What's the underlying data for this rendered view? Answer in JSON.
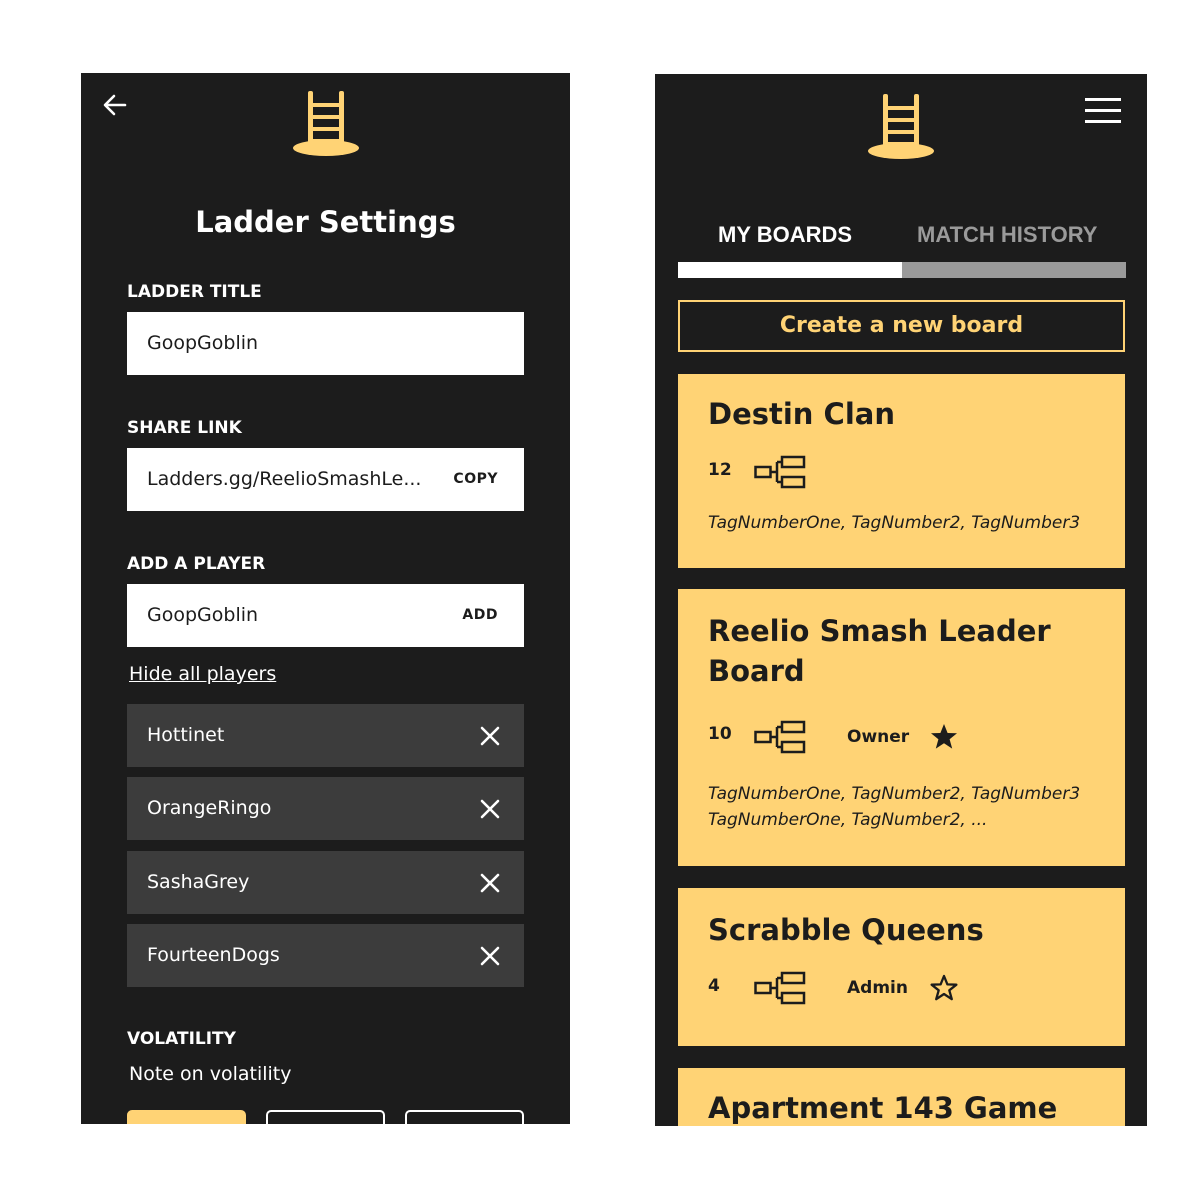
{
  "settings": {
    "title": "Ladder Settings",
    "ladder_title_label": "LADDER TITLE",
    "ladder_title_value": "GoopGoblin",
    "share_link_label": "SHARE LINK",
    "share_link_value": "Ladders.gg/ReelioSmashLe...",
    "copy_label": "COPY",
    "add_player_label": "ADD A PLAYER",
    "add_player_value": "GoopGoblin",
    "add_label": "ADD",
    "hide_players_link": "Hide all players",
    "players": [
      "Hottinet",
      "OrangeRingo",
      "SashaGrey",
      "FourteenDogs"
    ],
    "volatility_label": "VOLATILITY",
    "volatility_note": "Note on volatility"
  },
  "boards": {
    "tabs": [
      "MY BOARDS",
      "MATCH HISTORY"
    ],
    "active_tab": "MY BOARDS",
    "create_button": "Create a new board",
    "cards": [
      {
        "title": "Destin Clan",
        "count": "12",
        "role": "",
        "starred": false,
        "tags": [
          "TagNumberOne, TagNumber2, TagNumber3"
        ]
      },
      {
        "title_lines": [
          "Reelio Smash Leader",
          "Board"
        ],
        "count": "10",
        "role": "Owner",
        "starred": true,
        "tags": [
          "TagNumberOne, TagNumber2, TagNumber3",
          "TagNumberOne, TagNumber2, ..."
        ]
      },
      {
        "title": "Scrabble Queens",
        "count": "4",
        "role": "Admin",
        "starred": false,
        "tags": []
      },
      {
        "title": "Apartment 143 Game"
      }
    ]
  },
  "colors": {
    "background": "#1c1c1c",
    "accent": "#ffd375",
    "row_dark": "#3c3c3c",
    "tab_inactive": "#9a9a9a"
  },
  "icons": [
    "back-arrow-icon",
    "ladder-logo-icon",
    "close-icon",
    "hamburger-menu-icon",
    "bracket-icon",
    "star-filled-icon",
    "star-outline-icon"
  ]
}
